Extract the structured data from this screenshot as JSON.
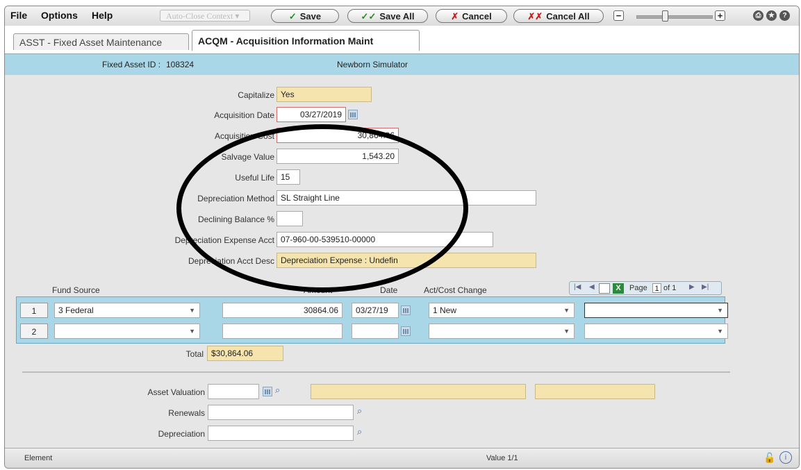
{
  "menu": {
    "file": "File",
    "options": "Options",
    "help": "Help",
    "auto_close": "Auto-Close Context",
    "save": "Save",
    "save_all": "Save All",
    "cancel": "Cancel",
    "cancel_all": "Cancel All"
  },
  "tabs": [
    {
      "label": "ASST - Fixed Asset Maintenance"
    },
    {
      "label": "ACQM - Acquisition Information Maint"
    }
  ],
  "header": {
    "fixed_asset_id_label": "Fixed Asset ID :",
    "fixed_asset_id": "108324",
    "description": "Newborn Simulator"
  },
  "form": {
    "capitalize_label": "Capitalize",
    "capitalize": "Yes",
    "acq_date_label": "Acquisition Date",
    "acq_date": "03/27/2019",
    "acq_cost_label": "Acquisition Cost",
    "acq_cost": "30,864.06",
    "salvage_label": "Salvage Value",
    "salvage": "1,543.20",
    "useful_life_label": "Useful Life",
    "useful_life": "15",
    "dep_method_label": "Depreciation Method",
    "dep_method": "SL Straight Line",
    "declining_label": "Declining Balance %",
    "declining": "",
    "dep_exp_acct_label": "Depreciation Expense Acct",
    "dep_exp_acct": "07-960-00-539510-00000",
    "dep_acct_desc_label": "Depreciation Acct Desc",
    "dep_acct_desc": "Depreciation Expense : Undefin"
  },
  "grid": {
    "headers": {
      "fund_source": "Fund Source",
      "amount": "Amount",
      "date": "Date",
      "act_cost": "Act/Cost Change"
    },
    "pager": {
      "page_label": "Page",
      "page": "1",
      "of": "of 1"
    },
    "rows": [
      {
        "num": "1",
        "fund": "3 Federal",
        "amount": "30864.06",
        "date": "03/27/19",
        "act": "1 New",
        "extra": ""
      },
      {
        "num": "2",
        "fund": "",
        "amount": "",
        "date": "",
        "act": "",
        "extra": ""
      }
    ],
    "total_label": "Total",
    "total": "$30,864.06"
  },
  "lower": {
    "asset_valuation_label": "Asset Valuation",
    "renewals_label": "Renewals",
    "depreciation_label": "Depreciation"
  },
  "status": {
    "left": "Element",
    "center": "Value 1/1"
  }
}
